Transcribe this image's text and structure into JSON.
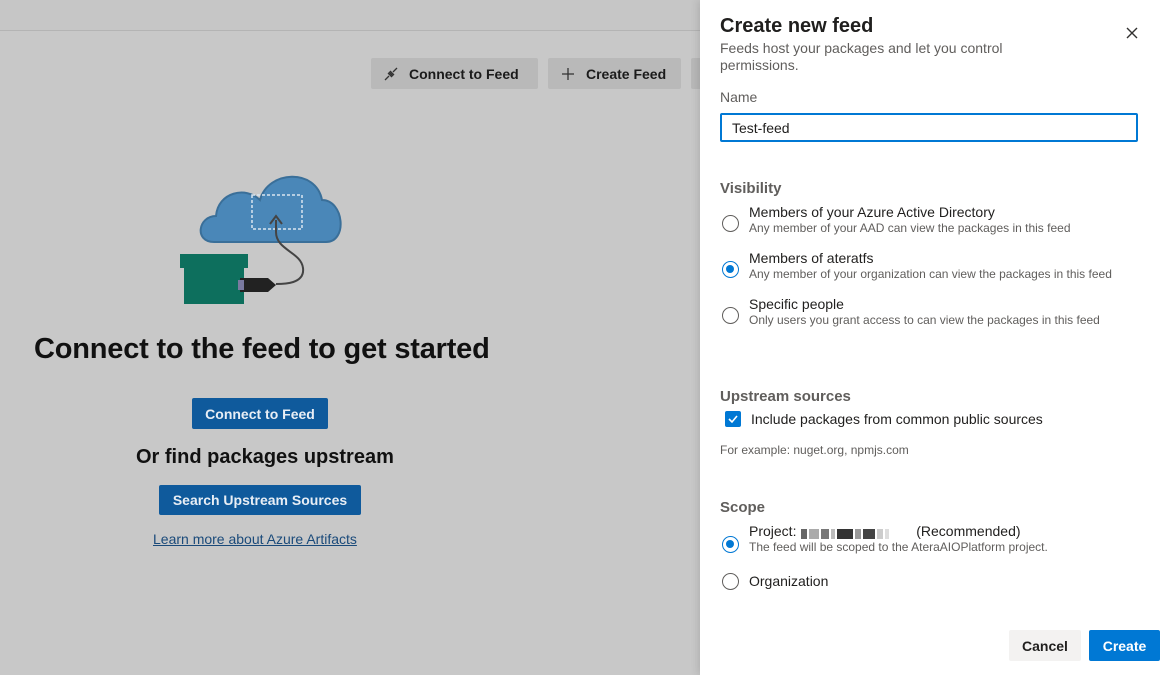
{
  "toolbar": {
    "connect_label": "Connect to Feed",
    "create_label": "Create Feed"
  },
  "empty_state": {
    "title": "Connect to the feed to get started",
    "connect_button": "Connect to Feed",
    "subtitle": "Or find packages upstream",
    "search_button": "Search Upstream Sources",
    "learn_link": "Learn more about Azure Artifacts"
  },
  "panel": {
    "title": "Create new feed",
    "subtitle": "Feeds host your packages and let you control permissions.",
    "name_label": "Name",
    "name_value": "Test-feed",
    "visibility": {
      "heading": "Visibility",
      "options": [
        {
          "label": "Members of your Azure Active Directory",
          "desc": "Any member of your AAD can view the packages in this feed",
          "selected": false
        },
        {
          "label": "Members of ateratfs",
          "desc": "Any member of your organization can view the packages in this feed",
          "selected": true
        },
        {
          "label": "Specific people",
          "desc": "Only users you grant access to can view the packages in this feed",
          "selected": false
        }
      ]
    },
    "upstream": {
      "heading": "Upstream sources",
      "checkbox_label": "Include packages from common public sources",
      "checked": true,
      "hint": "For example: nuget.org, npmjs.com"
    },
    "scope": {
      "heading": "Scope",
      "project_prefix": "Project:",
      "project_suffix": "(Recommended)",
      "project_desc": "The feed will be scoped to the AteraAIOPlatform project.",
      "organization_label": "Organization"
    },
    "cancel_label": "Cancel",
    "create_label": "Create"
  },
  "colors": {
    "accent": "#0078d4",
    "overlay_primary": "#0f5a9c"
  }
}
